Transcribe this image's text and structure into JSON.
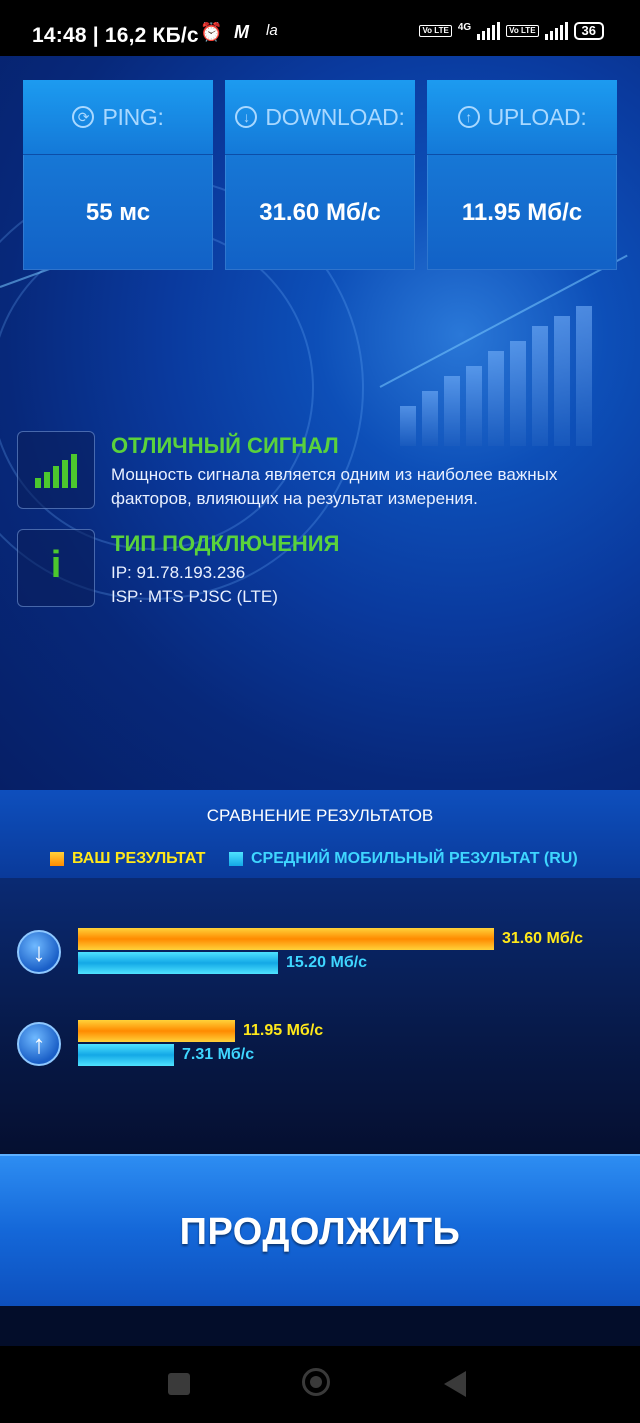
{
  "status_bar": {
    "time_speed": "14:48 | 16,2 КБ/с",
    "network": "4G",
    "volte": "Vo LTE",
    "battery": "36"
  },
  "metrics": [
    {
      "label": "PING:",
      "value": "55 мс",
      "icon": "ping-icon"
    },
    {
      "label": "DOWNLOAD:",
      "value": "31.60 Мб/с",
      "icon": "download-icon"
    },
    {
      "label": "UPLOAD:",
      "value": "11.95 Мб/с",
      "icon": "upload-icon"
    }
  ],
  "signal": {
    "title": "ОТЛИЧНЫЙ СИГНАЛ",
    "text": "Мощность сигнала является одним из наиболее важных факторов, влияющих на результат измерения."
  },
  "connection": {
    "title": "ТИП ПОДКЛЮЧЕНИЯ",
    "ip": "IP: 91.78.193.236",
    "isp": "ISP: MTS PJSC (LTE)",
    "icon_glyph": "i"
  },
  "comparison": {
    "title": "СРАВНЕНИЕ РЕЗУЛЬТАТОВ",
    "legend_yours": "ВАШ РЕЗУЛЬТАТ",
    "legend_avg": "СРЕДНИЙ МОБИЛЬНЫЙ РЕЗУЛЬТАТ (RU)",
    "download": {
      "yours_label": "31.60 Мб/с",
      "yours_value": 31.6,
      "avg_label": "15.20 Мб/с",
      "avg_value": 15.2
    },
    "upload": {
      "yours_label": "11.95 Мб/с",
      "yours_value": 11.95,
      "avg_label": "7.31 Мб/с",
      "avg_value": 7.31
    },
    "colors": {
      "yours": "#ff9a00",
      "avg": "#1fc3f0",
      "yours_text": "#ffe81a",
      "avg_text": "#3fd6ff"
    }
  },
  "continue_label": "ПРОДОЛЖИТЬ"
}
